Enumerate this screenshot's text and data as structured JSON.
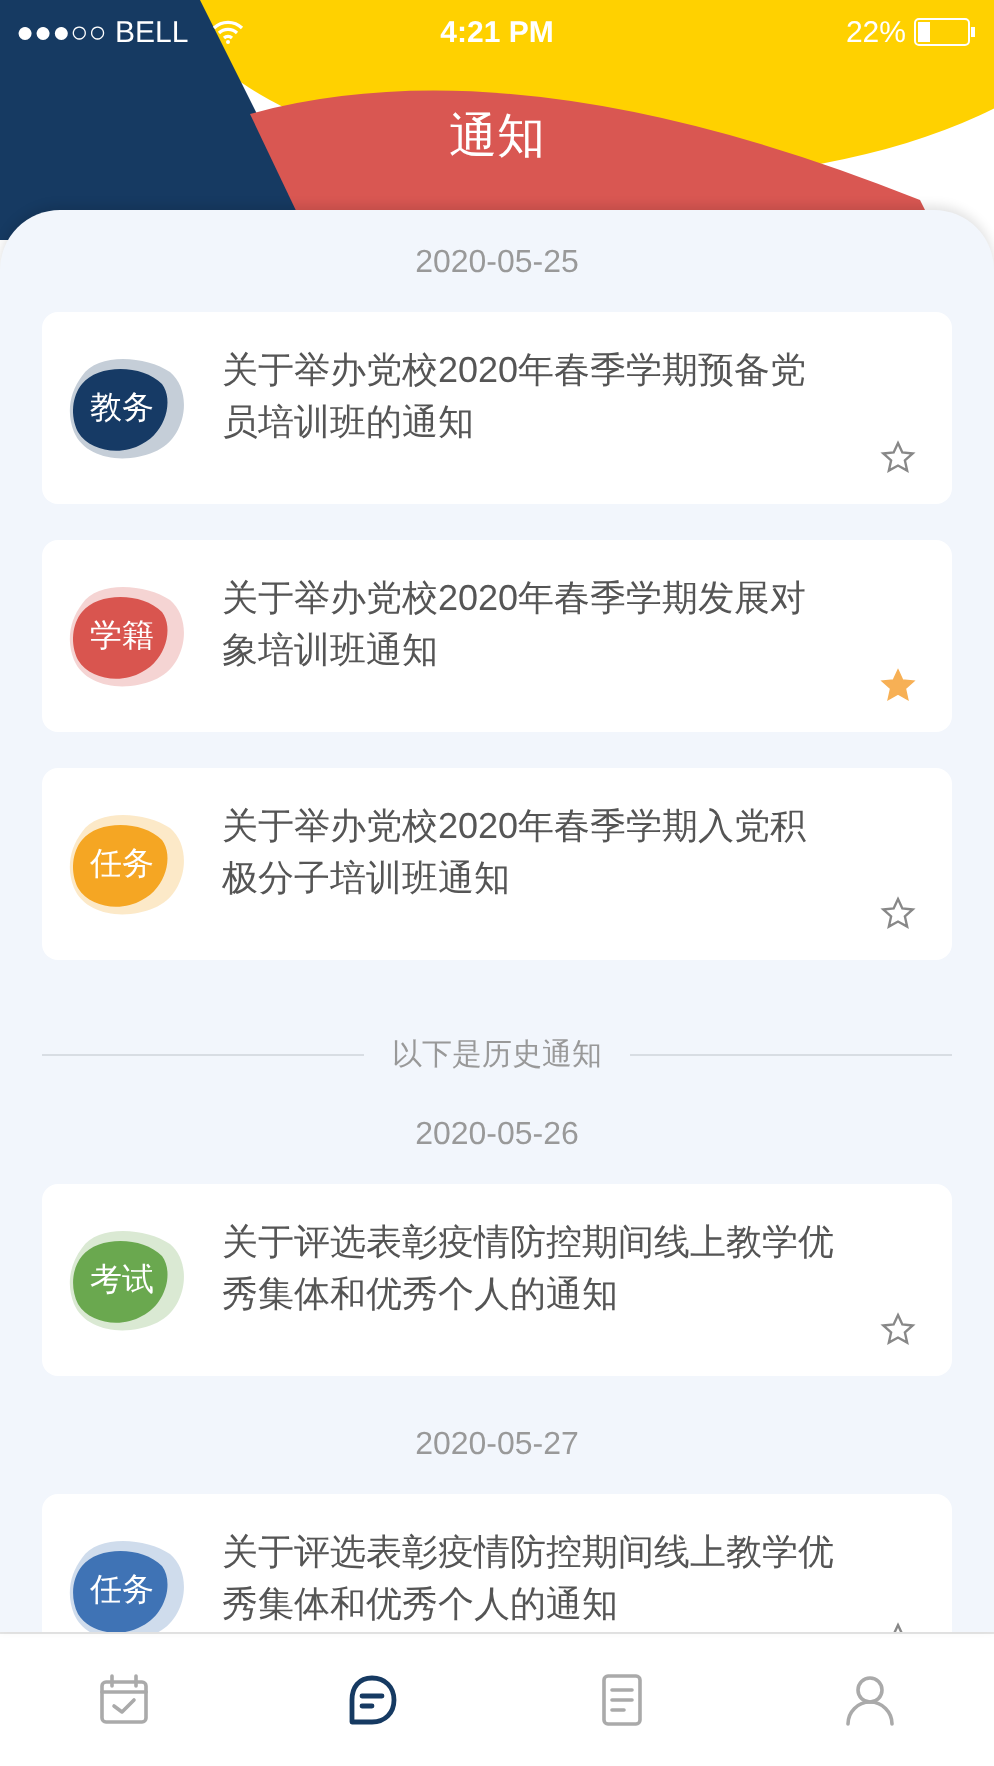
{
  "status_bar": {
    "carrier": "●●●○○ BELL",
    "time": "4:21 PM",
    "battery": "22%"
  },
  "header": {
    "title": "通知"
  },
  "sections": [
    {
      "kind": "date",
      "text": "2020-05-25"
    },
    {
      "kind": "notice",
      "tag": "教务",
      "color": "#163a65",
      "title": "关于举办党校2020年春季学期预备党员培训班的通知",
      "starred": false
    },
    {
      "kind": "notice",
      "tag": "学籍",
      "color": "#d9554f",
      "title": "关于举办党校2020年春季学期发展对象培训班通知",
      "starred": true
    },
    {
      "kind": "notice",
      "tag": "任务",
      "color": "#f5a623",
      "title": "关于举办党校2020年春季学期入党积极分子培训班通知",
      "starred": false
    },
    {
      "kind": "divider",
      "text": "以下是历史通知"
    },
    {
      "kind": "date",
      "text": "2020-05-26"
    },
    {
      "kind": "notice",
      "tag": "考试",
      "color": "#6aa84f",
      "title": "关于评选表彰疫情防控期间线上教学优秀集体和优秀个人的通知",
      "starred": false
    },
    {
      "kind": "date",
      "text": "2020-05-27"
    },
    {
      "kind": "notice",
      "tag": "任务",
      "color": "#3f73b5",
      "title": "关于评选表彰疫情防控期间线上教学优秀集体和优秀个人的通知",
      "starred": false
    }
  ],
  "tab_bar": [
    {
      "kind": "calendar",
      "selected": false
    },
    {
      "kind": "chat",
      "selected": true
    },
    {
      "kind": "document",
      "selected": false
    },
    {
      "kind": "user",
      "selected": false
    }
  ]
}
